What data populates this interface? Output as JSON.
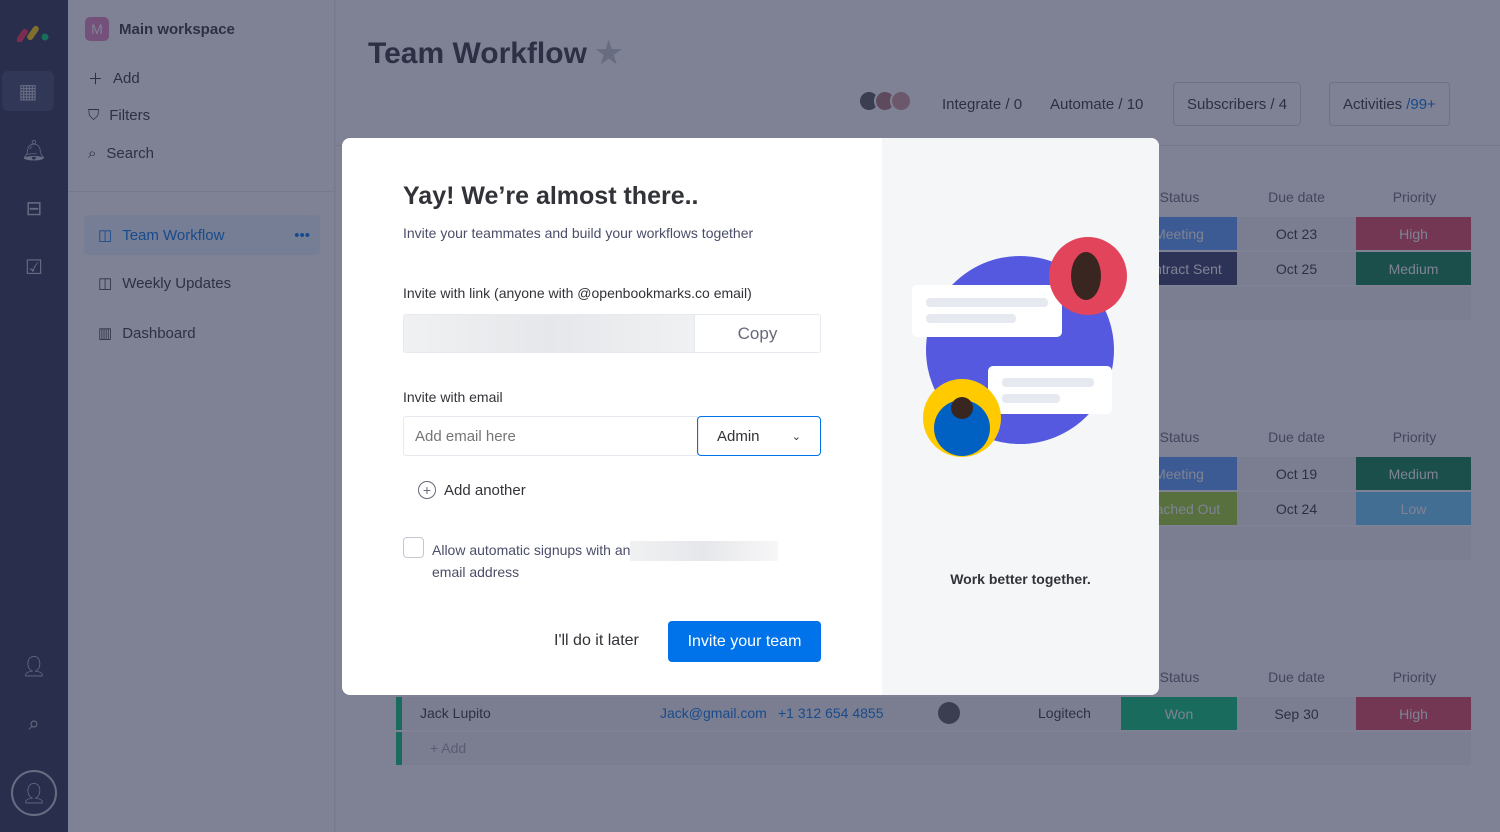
{
  "nav": {
    "icons": [
      "logo-icon",
      "grid-icon",
      "bell-icon",
      "inbox-icon",
      "checklist-icon",
      "add-user-icon",
      "search-icon",
      "avatar-icon"
    ]
  },
  "workspace": {
    "badge": "M",
    "name": "Main workspace",
    "add": "Add",
    "filters": "Filters",
    "search": "Search",
    "boards": [
      {
        "label": "Team Workflow",
        "active": true,
        "more": "•••"
      },
      {
        "label": "Weekly Updates"
      },
      {
        "label": "Dashboard"
      }
    ]
  },
  "board": {
    "title": "Team Workflow",
    "integrate": "Integrate / 0",
    "automate": "Automate / 10",
    "subscribers": "Subscribers / 4",
    "activities": "Activities",
    "activities_count": "/99+",
    "headers": {
      "status": "Status",
      "due": "Due date",
      "priority": "Priority"
    },
    "groups": [
      {
        "rows": [
          {
            "status": "Meeting",
            "status_color": "#579bfc",
            "due": "Oct 23",
            "priority": "High",
            "priority_color": "#e2445c"
          },
          {
            "status": "Contract Sent",
            "status_color": "#323768",
            "due": "Oct 25",
            "priority": "Medium",
            "priority_color": "#037f4c"
          }
        ]
      },
      {
        "rows": [
          {
            "status": "Meeting",
            "status_color": "#579bfc",
            "due": "Oct 19",
            "priority": "Medium",
            "priority_color": "#037f4c"
          },
          {
            "status": "Reached Out",
            "status_color": "#9cd326",
            "due": "Oct 24",
            "priority": "Low",
            "priority_color": "#66ccff"
          }
        ]
      },
      {
        "rows": [
          {
            "name": "Jack Lupito",
            "email": "Jack@gmail.com",
            "phone": "+1 312 654 4855",
            "company": "Logitech",
            "status": "Won",
            "status_color": "#00c875",
            "due": "Sep 30",
            "priority": "High",
            "priority_color": "#e2445c"
          }
        ],
        "add": "+ Add"
      }
    ]
  },
  "modal": {
    "title": "Yay! We’re almost there..",
    "subtitle": "Invite your teammates and build your workflows together",
    "link_label": "Invite with link  (anyone with @openbookmarks.co email)",
    "copy": "Copy",
    "email_label": "Invite with email",
    "email_placeholder": "Add email here",
    "role": "Admin",
    "add_another": "Add another",
    "checkbox_label_1": "Allow automatic signups with an",
    "checkbox_label_2": "email address",
    "checkbox_checked": false,
    "later": "I'll do it later",
    "invite": "Invite your team",
    "tagline": "Work better together.",
    "accent": "#0073ea"
  }
}
